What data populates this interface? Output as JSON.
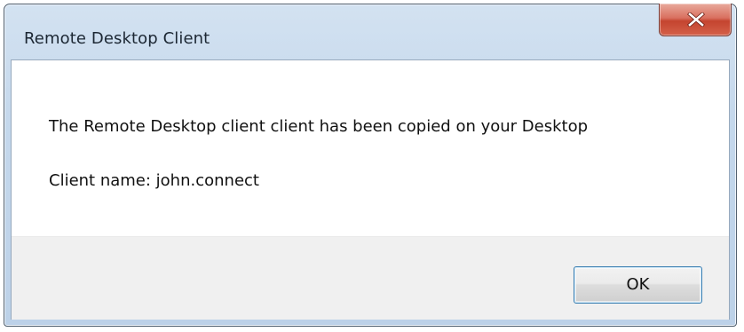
{
  "window": {
    "title": "Remote Desktop Client",
    "close_icon": "close-x-icon"
  },
  "dialog": {
    "message": "The Remote Desktop client client has been copied on your Desktop",
    "client_name_line": "Client name: john.connect"
  },
  "buttons": {
    "ok_label": "OK"
  },
  "colors": {
    "close_button": "#c4442f",
    "ok_border": "#3c7fb1",
    "frame": "#bcd1e8"
  }
}
